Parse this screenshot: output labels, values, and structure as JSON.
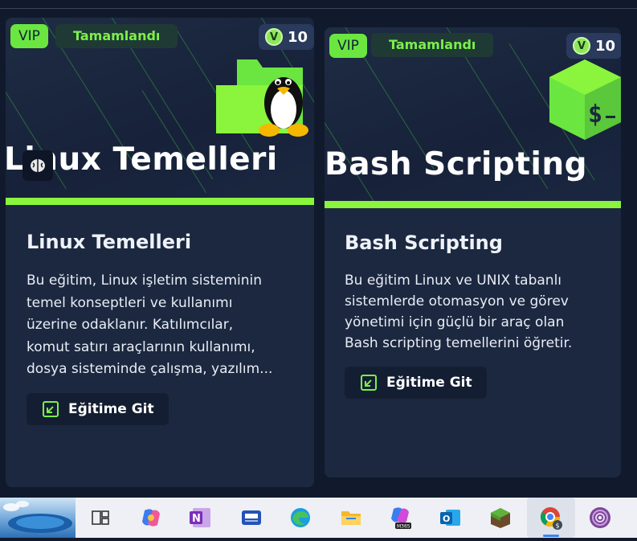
{
  "cards": [
    {
      "vip_label": "VIP",
      "status_label": "Tamamlandı",
      "points": "10",
      "points_coin": "V",
      "banner_title": "Linux Temelleri",
      "title": "Linux Temelleri",
      "description": "Bu eğitim, Linux işletim sisteminin\ntemel konseptleri ve kullanımı\nüzerine odaklanır. Katılımcılar,\nkomut satırı araçlarının kullanımı,\ndosya sisteminde çalışma, yazılım...",
      "button_label": "Eğitime Git",
      "banner_icon": "linux-tux-folder-icon"
    },
    {
      "vip_label": "VIP",
      "status_label": "Tamamlandı",
      "points": "10",
      "points_coin": "V",
      "banner_title": "Bash Scripting",
      "title": "Bash Scripting",
      "description": "Bu eğitim Linux ve UNIX tabanlı\nsistemlerde otomasyon ve görev\nyönetimi için güçlü bir araç olan\nBash scripting temellerini öğretir.",
      "button_label": "Eğitime Git",
      "banner_icon": "bash-terminal-cube-icon"
    }
  ],
  "colors": {
    "page_bg": "#111a2c",
    "card_bg": "#1b2840",
    "accent_green": "#8af53c",
    "vip_bg": "#6be640",
    "status_text": "#7cf04a"
  },
  "taskbar": {
    "items": [
      "weather-widget",
      "task-view-icon",
      "copilot-icon",
      "onenote-icon",
      "scanner-app-icon",
      "edge-icon",
      "file-explorer-icon",
      "m365-copilot-icon",
      "outlook-icon",
      "minecraft-icon",
      "chrome-icon",
      "tor-browser-icon"
    ],
    "m365_badge": "M365",
    "onenote_letter": "N",
    "outlook_letter": "O"
  }
}
